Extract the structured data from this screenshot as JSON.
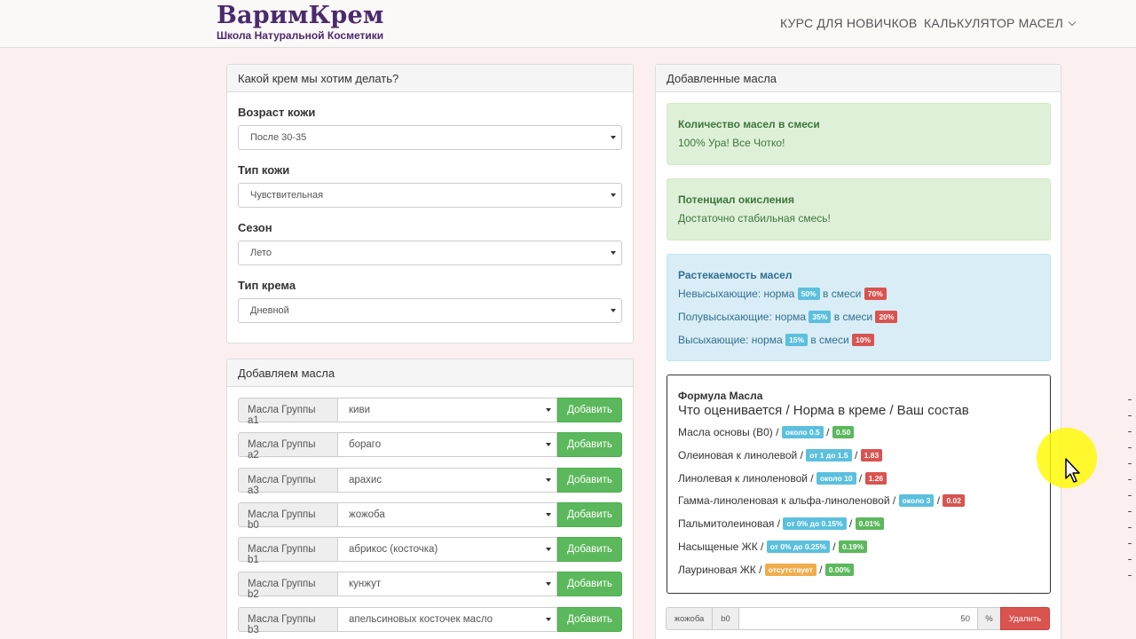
{
  "brand": {
    "title": "ВаримКрем",
    "subtitle": "Школа Натуральной Косметики"
  },
  "nav": {
    "item1": "КУРС ДЛЯ НОВИЧКОВ",
    "item2": "КАЛЬКУЛЯТОР МАСЕЛ"
  },
  "cream_panel": {
    "heading": "Какой крем мы хотим делать?",
    "fields": [
      {
        "label": "Возраст кожи",
        "value": "После 30-35"
      },
      {
        "label": "Тип кожи",
        "value": "Чувствительная"
      },
      {
        "label": "Сезон",
        "value": "Лето"
      },
      {
        "label": "Тип крема",
        "value": "Дневной"
      }
    ]
  },
  "oils_panel": {
    "heading": "Добавляем масла",
    "button_label": "Добавить",
    "rows": [
      {
        "group": "Масла Группы a1",
        "value": "киви"
      },
      {
        "group": "Масла Группы a2",
        "value": "бораго"
      },
      {
        "group": "Масла Группы a3",
        "value": "арахис"
      },
      {
        "group": "Масла Группы b0",
        "value": "жожоба"
      },
      {
        "group": "Масла Группы b1",
        "value": "абрикос (косточка)"
      },
      {
        "group": "Масла Группы b2",
        "value": "кунжут"
      },
      {
        "group": "Масла Группы b3",
        "value": "апельсиновых косточек масло"
      }
    ]
  },
  "added_panel": {
    "heading": "Добавленные масла",
    "quantity": {
      "title": "Количество масел в смеси",
      "text": "100% Ура! Все Чотко!"
    },
    "oxidation": {
      "title": "Потенциал окисления",
      "text": "Достаточно стабильная смесь!"
    },
    "spread": {
      "title": "Растекаемость масел",
      "norm_word": "норма",
      "in_mix": "в смеси",
      "lines": [
        {
          "label": "Невысыхающие:",
          "norm": "50%",
          "mix": "70%"
        },
        {
          "label": "Полувысыхающие:",
          "norm": "35%",
          "mix": "20%"
        },
        {
          "label": "Высыхающие:",
          "norm": "15%",
          "mix": "10%"
        }
      ]
    },
    "formula": {
      "title": "Формула Масла",
      "subtitle": "Что оценивается / Норма в креме / Ваш состав",
      "lines": [
        {
          "label": "Масла основы (B0) /",
          "norm": "около 0.5",
          "value": "0.50",
          "norm_color": "info",
          "value_color": "success"
        },
        {
          "label": "Олеиновая к линолевой /",
          "norm": "от 1 до 1.5",
          "value": "1.83",
          "norm_color": "info",
          "value_color": "danger"
        },
        {
          "label": "Линолевая к линоленовой /",
          "norm": "около 10",
          "value": "1.26",
          "norm_color": "info",
          "value_color": "danger"
        },
        {
          "label": "Гамма-линоленовая к альфа-линоленовой /",
          "norm": "около 3",
          "value": "0.02",
          "norm_color": "info",
          "value_color": "danger"
        },
        {
          "label": "Пальмитолеиновая /",
          "norm": "от 0% до 0.15%",
          "value": "0.01%",
          "norm_color": "info",
          "value_color": "success"
        },
        {
          "label": "Насыщеные ЖК /",
          "norm": "от 0% до 0.25%",
          "value": "0.19%",
          "norm_color": "info",
          "value_color": "success"
        },
        {
          "label": "Лауриновая ЖК /",
          "norm": "отсутствует",
          "value": "0.00%",
          "norm_color": "warning",
          "value_color": "success"
        }
      ]
    },
    "added_row": {
      "oil": "жожоба",
      "group": "b0",
      "amount": "50",
      "unit": "%",
      "delete_label": "Удалить"
    }
  }
}
